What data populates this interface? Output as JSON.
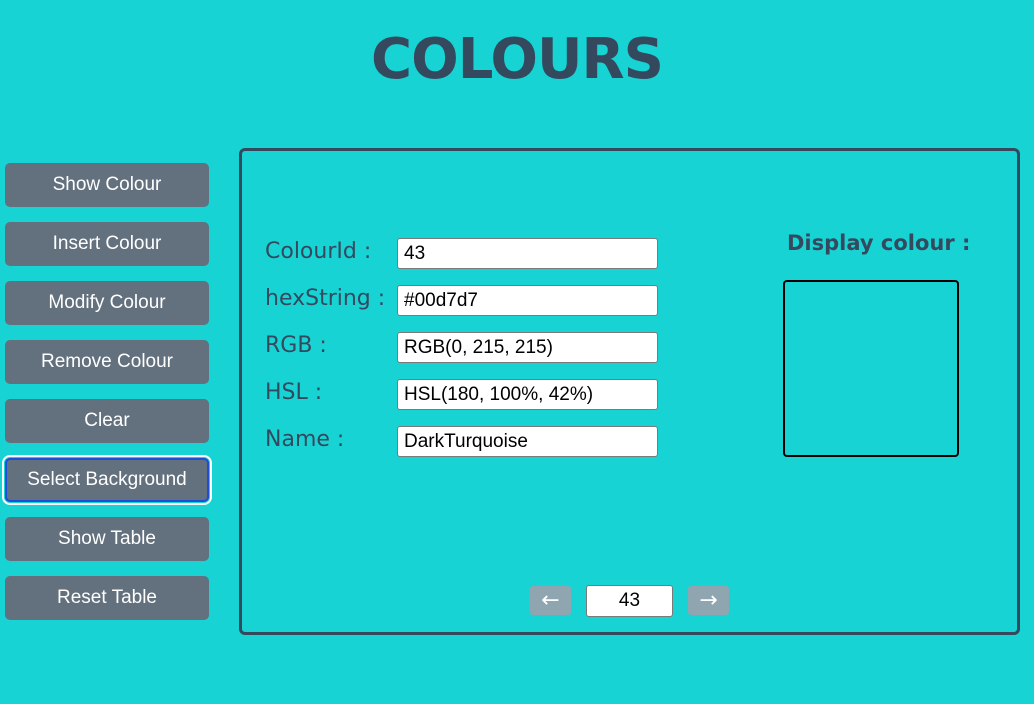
{
  "header": {
    "title": "COLOURS"
  },
  "sidebar": {
    "buttons": [
      {
        "label": "Show Colour"
      },
      {
        "label": "Insert Colour"
      },
      {
        "label": "Modify Colour"
      },
      {
        "label": "Remove Colour"
      },
      {
        "label": "Clear"
      },
      {
        "label": "Select Background",
        "focused": true
      },
      {
        "label": "Show Table"
      },
      {
        "label": "Reset Table"
      }
    ]
  },
  "form": {
    "fields": [
      {
        "label": "ColourId :",
        "value": "43"
      },
      {
        "label": "hexString :",
        "value": "#00d7d7"
      },
      {
        "label": "RGB :",
        "value": "RGB(0, 215, 215)"
      },
      {
        "label": "HSL :",
        "value": "HSL(180, 100%, 42%)"
      },
      {
        "label": "Name :",
        "value": "DarkTurquoise"
      }
    ]
  },
  "display": {
    "label": "Display colour :",
    "swatch_color": "#17d3d4"
  },
  "pagination": {
    "prev_icon": "left-arrow-icon",
    "prev_glyph": "←",
    "current_value": "43",
    "next_icon": "right-arrow-icon",
    "next_glyph": "→"
  },
  "colors": {
    "background": "#17d3d4",
    "button": "#63707d",
    "text": "#34495e",
    "nav_button": "#8fa6b0"
  }
}
